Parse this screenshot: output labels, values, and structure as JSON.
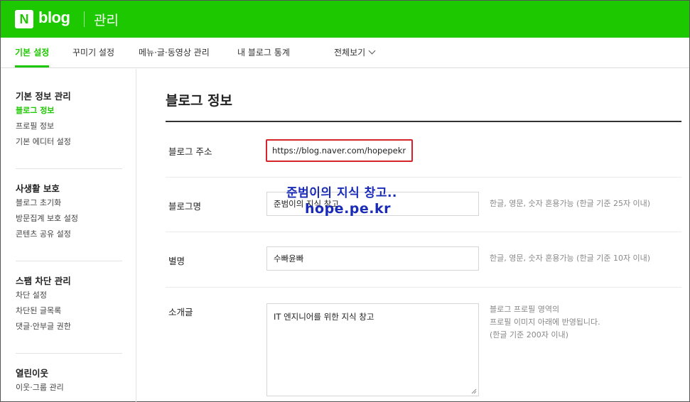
{
  "header": {
    "logo_letter": "N",
    "logo_text": "blog",
    "section_title": "관리"
  },
  "tabs": [
    {
      "label": "기본 설정",
      "active": true
    },
    {
      "label": "꾸미기 설정",
      "active": false
    },
    {
      "label": "메뉴·글·동영상 관리",
      "active": false
    },
    {
      "label": "내 블로그 통계",
      "active": false
    },
    {
      "label": "전체보기",
      "active": false
    }
  ],
  "sidebar": {
    "groups": [
      {
        "title": "기본 정보 관리",
        "items": [
          "블로그 정보",
          "프로필 정보",
          "기본 에디터 설정"
        ],
        "active_item": "블로그 정보"
      },
      {
        "title": "사생활 보호",
        "items": [
          "블로그 초기화",
          "방문집계 보호 설정",
          "콘텐츠 공유 설정"
        ]
      },
      {
        "title": "스팸 차단 관리",
        "items": [
          "차단 설정",
          "차단된 글목록",
          "댓글·안부글 권한"
        ]
      },
      {
        "title": "열린이웃",
        "items": [
          "이웃·그룹 관리"
        ]
      }
    ]
  },
  "main": {
    "title": "블로그 정보",
    "fields": {
      "address": {
        "label": "블로그 주소",
        "value": "https://blog.naver.com/hopepekr"
      },
      "name": {
        "label": "블로그명",
        "value": "준범이의 지식 창고",
        "hint": "한글, 영문, 숫자 혼용가능 (한글 기준 25자 이내)"
      },
      "nickname": {
        "label": "별명",
        "value": "수빠윤빠",
        "hint": "한글, 영문, 숫자 혼용가능 (한글 기준 10자 이내)"
      },
      "intro": {
        "label": "소개글",
        "value": "IT 엔지니어를 위한 지식 창고",
        "hint_lines": [
          "블로그 프로필 영역의",
          "프로필 이미지 아래에 반영됩니다.",
          "(한글 기준 200자 이내)"
        ]
      }
    }
  },
  "overlay": {
    "line1": "준범이의 지식 창고..",
    "line2": "hope.pe.kr"
  }
}
